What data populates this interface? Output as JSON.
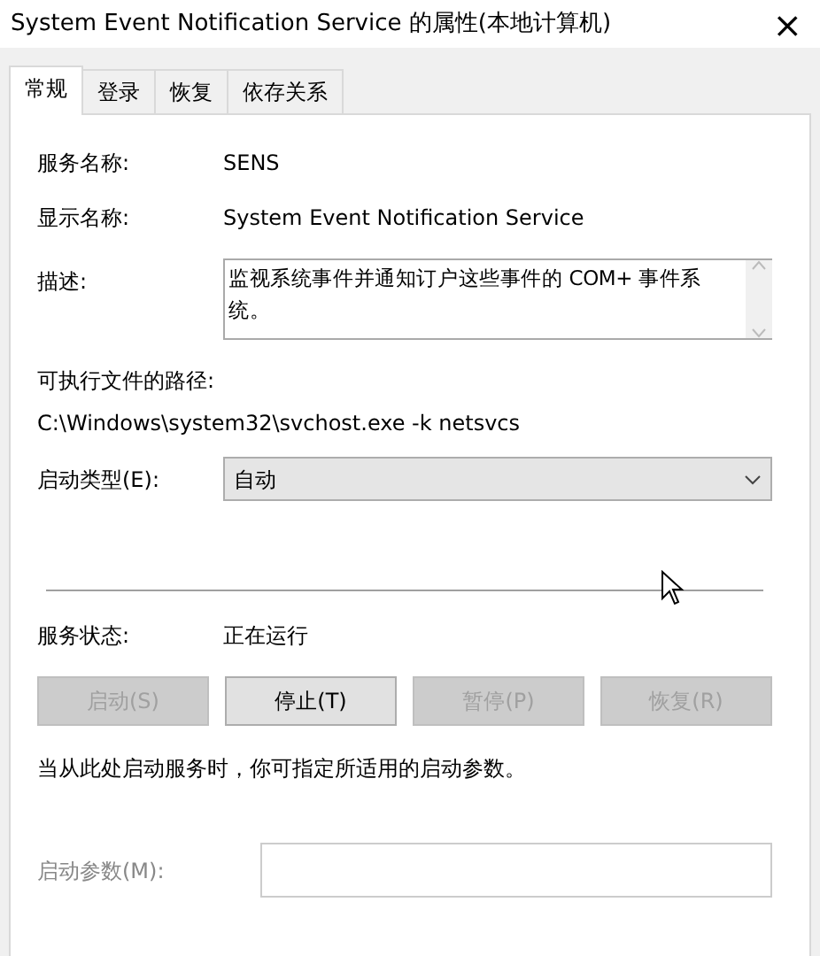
{
  "window": {
    "title": "System Event Notification Service 的属性(本地计算机)",
    "close": "×"
  },
  "tabs": [
    {
      "label": "常规",
      "selected": true
    },
    {
      "label": "登录",
      "selected": false
    },
    {
      "label": "恢复",
      "selected": false
    },
    {
      "label": "依存关系",
      "selected": false
    }
  ],
  "service_name": {
    "label": "服务名称:",
    "value": "SENS"
  },
  "display_name": {
    "label": "显示名称:",
    "value": "System Event Notification Service"
  },
  "description": {
    "label": "描述:",
    "value": "监视系统事件并通知订户这些事件的 COM+ 事件系统。"
  },
  "executable_path": {
    "label": "可执行文件的路径:",
    "value": "C:\\Windows\\system32\\svchost.exe -k netsvcs"
  },
  "startup_type": {
    "label": "启动类型(E):",
    "value": "自动"
  },
  "service_status": {
    "label": "服务状态:",
    "value": "正在运行"
  },
  "buttons": [
    {
      "label": "启动(S)",
      "disabled": true
    },
    {
      "label": "停止(T)",
      "disabled": false
    },
    {
      "label": "暂停(P)",
      "disabled": true
    },
    {
      "label": "恢复(R)",
      "disabled": true
    }
  ],
  "hint": "当从此处启动服务时，你可指定所适用的启动参数。",
  "start_parameters": {
    "label": "启动参数(M):",
    "disabled": true
  }
}
